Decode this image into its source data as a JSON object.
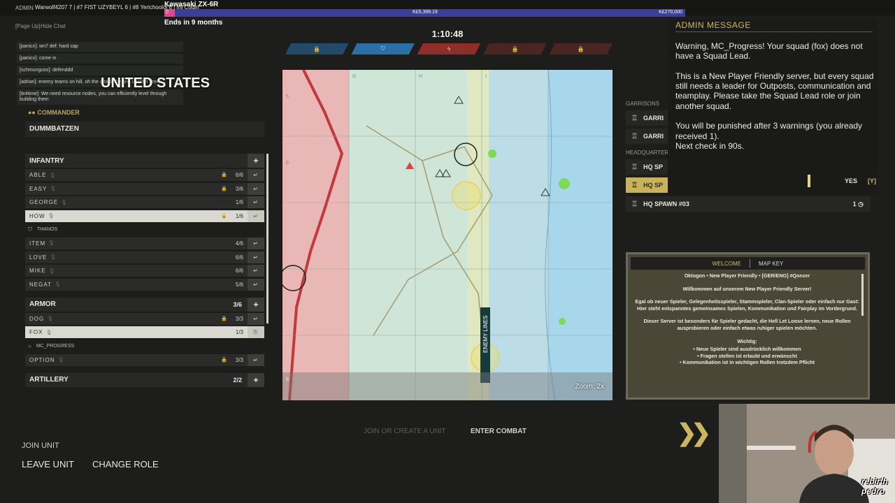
{
  "overlay": {
    "admin_tag": "ADMIN",
    "ticker": "Warwolf4207 7 | #7 FIST UZYBEYL 6 | #8 Yerichoolol 6 | #9 Codin",
    "goal_title": "Kawasaki ZX-6R",
    "goal_start": "0",
    "goal_current": "K£5,399.19",
    "goal_max": "K£270,000",
    "goal_progress": 0.02,
    "goal_ends": "Ends in 9 months",
    "page_up": "[Page Up]",
    "hide_chat": "Hide Chat"
  },
  "match": {
    "timer": "1:10:48",
    "sectors": [
      {
        "owner": "us",
        "icon": "lock-icon",
        "glyph": "🔒"
      },
      {
        "owner": "us-active",
        "icon": "shield-icon",
        "glyph": "⛉"
      },
      {
        "owner": "de-active",
        "icon": "bolt-icon",
        "glyph": "ϟ"
      },
      {
        "owner": "de",
        "icon": "lock-icon",
        "glyph": "🔒"
      },
      {
        "owner": "de",
        "icon": "lock-icon",
        "glyph": "🔒"
      }
    ]
  },
  "chat": [
    "[panicx]: wn7 def: hard cap",
    "[panicx]: come in",
    "[schmunguss]: defenddd",
    "[adrian]: enemy teams on hill, oh the attack the one upsider green",
    "[te4time]: We need resource nodes, you can efficiently level through building them"
  ],
  "faction": {
    "name": "UNITED STATES",
    "commander_label": "COMMANDER",
    "player_name": "DUMMBATZEN"
  },
  "categories": {
    "infantry": {
      "label": "INFANTRY",
      "units": [
        {
          "name": "ABLE",
          "count": "6/6",
          "locked": true,
          "selected": false
        },
        {
          "name": "EASY",
          "count": "3/6",
          "locked": true,
          "selected": false
        },
        {
          "name": "GEORGE",
          "count": "1/6",
          "locked": false,
          "selected": false
        },
        {
          "name": "HOW",
          "count": "1/6",
          "locked": true,
          "selected": true
        },
        {
          "name": "ITEM",
          "count": "4/6",
          "locked": false,
          "selected": false
        },
        {
          "name": "LOVE",
          "count": "6/6",
          "locked": false,
          "selected": false
        },
        {
          "name": "MIKE",
          "count": "6/6",
          "locked": false,
          "selected": false
        },
        {
          "name": "NEGAT",
          "count": "5/6",
          "locked": false,
          "selected": false
        }
      ],
      "how_leader": "THANOS"
    },
    "armor": {
      "label": "ARMOR",
      "count": "3/6",
      "units": [
        {
          "name": "DOG",
          "count": "3/3",
          "locked": true,
          "selected": false
        },
        {
          "name": "FOX",
          "count": "1/3",
          "locked": false,
          "selected": true
        },
        {
          "name": "OPTION",
          "count": "3/3",
          "locked": true,
          "selected": false
        }
      ],
      "fox_member": "MC_PROGRESS"
    },
    "artillery": {
      "label": "ARTILLERY",
      "count": "2/2"
    }
  },
  "map": {
    "zoom": "Zoom: 2x",
    "front_label": "ENEMY LINES",
    "grid_letters": [
      "G",
      "H",
      "I"
    ],
    "grid_numbers": [
      "5",
      "6",
      "9"
    ]
  },
  "spawns": {
    "garrisons_label": "GARRISONS",
    "hq_label": "HEADQUARTERS",
    "items": [
      {
        "label": "GARRI",
        "selected": false
      },
      {
        "label": "GARRI",
        "selected": false
      },
      {
        "label": "HQ SP",
        "selected": false
      },
      {
        "label": "HQ SP",
        "selected": true
      }
    ],
    "hq3": {
      "label": "HQ SPAWN #03",
      "count": "1"
    }
  },
  "admin_message": {
    "title": "ADMIN MESSAGE",
    "body": "Warning, MC_Progress! Your squad (fox) does not have a Squad Lead.\n\nThis is a New Player Friendly server, but every squad still needs a leader for Outposts, communication and teamplay. Please take the Squad Lead role or join another squad.\n\nYou will be punished after 3 warnings (you already received 1).\nNext check in 90s.",
    "yes_label": "YES",
    "yes_key": "[Y]"
  },
  "welcome": {
    "tab_welcome": "WELCOME",
    "tab_mapkey": "MAP KEY",
    "server_name": "Oktogon • New Player Friendly • [GER/ENG] #Qonzer",
    "greeting": "Willkommen auf unserem New Player Friendly Server!",
    "para1": "Egal ob neuer Spieler, Gelegenheitsspieler, Stammspieler, Clan-Spieler oder einfach nur Gast:\nHier steht entspanntes gemeinsames Spielen, Kommunikation und Fairplay im Vordergrund.",
    "para2": "Dieser Server ist besonders für Spieler gedacht, die Hell Let Loose lernen, neue Rollen ausprobieren oder einfach etwas ruhiger spielen möchten.",
    "important": "Wichtig:",
    "bullets": "• Neue Spieler sind ausdrücklich willkommen\n• Fragen stellen ist erlaubt und erwünscht\n• Kommunikation ist in wichtigen Rollen trotzdem Pflicht"
  },
  "actions": {
    "join_create": "JOIN OR CREATE A UNIT",
    "enter_combat": "ENTER COMBAT",
    "join_unit": "JOIN UNIT",
    "leave_unit": "LEAVE UNIT",
    "change_role": "CHANGE ROLE"
  },
  "webcam": {
    "logo_top": "rebirth",
    "logo_bottom": "pedro"
  }
}
